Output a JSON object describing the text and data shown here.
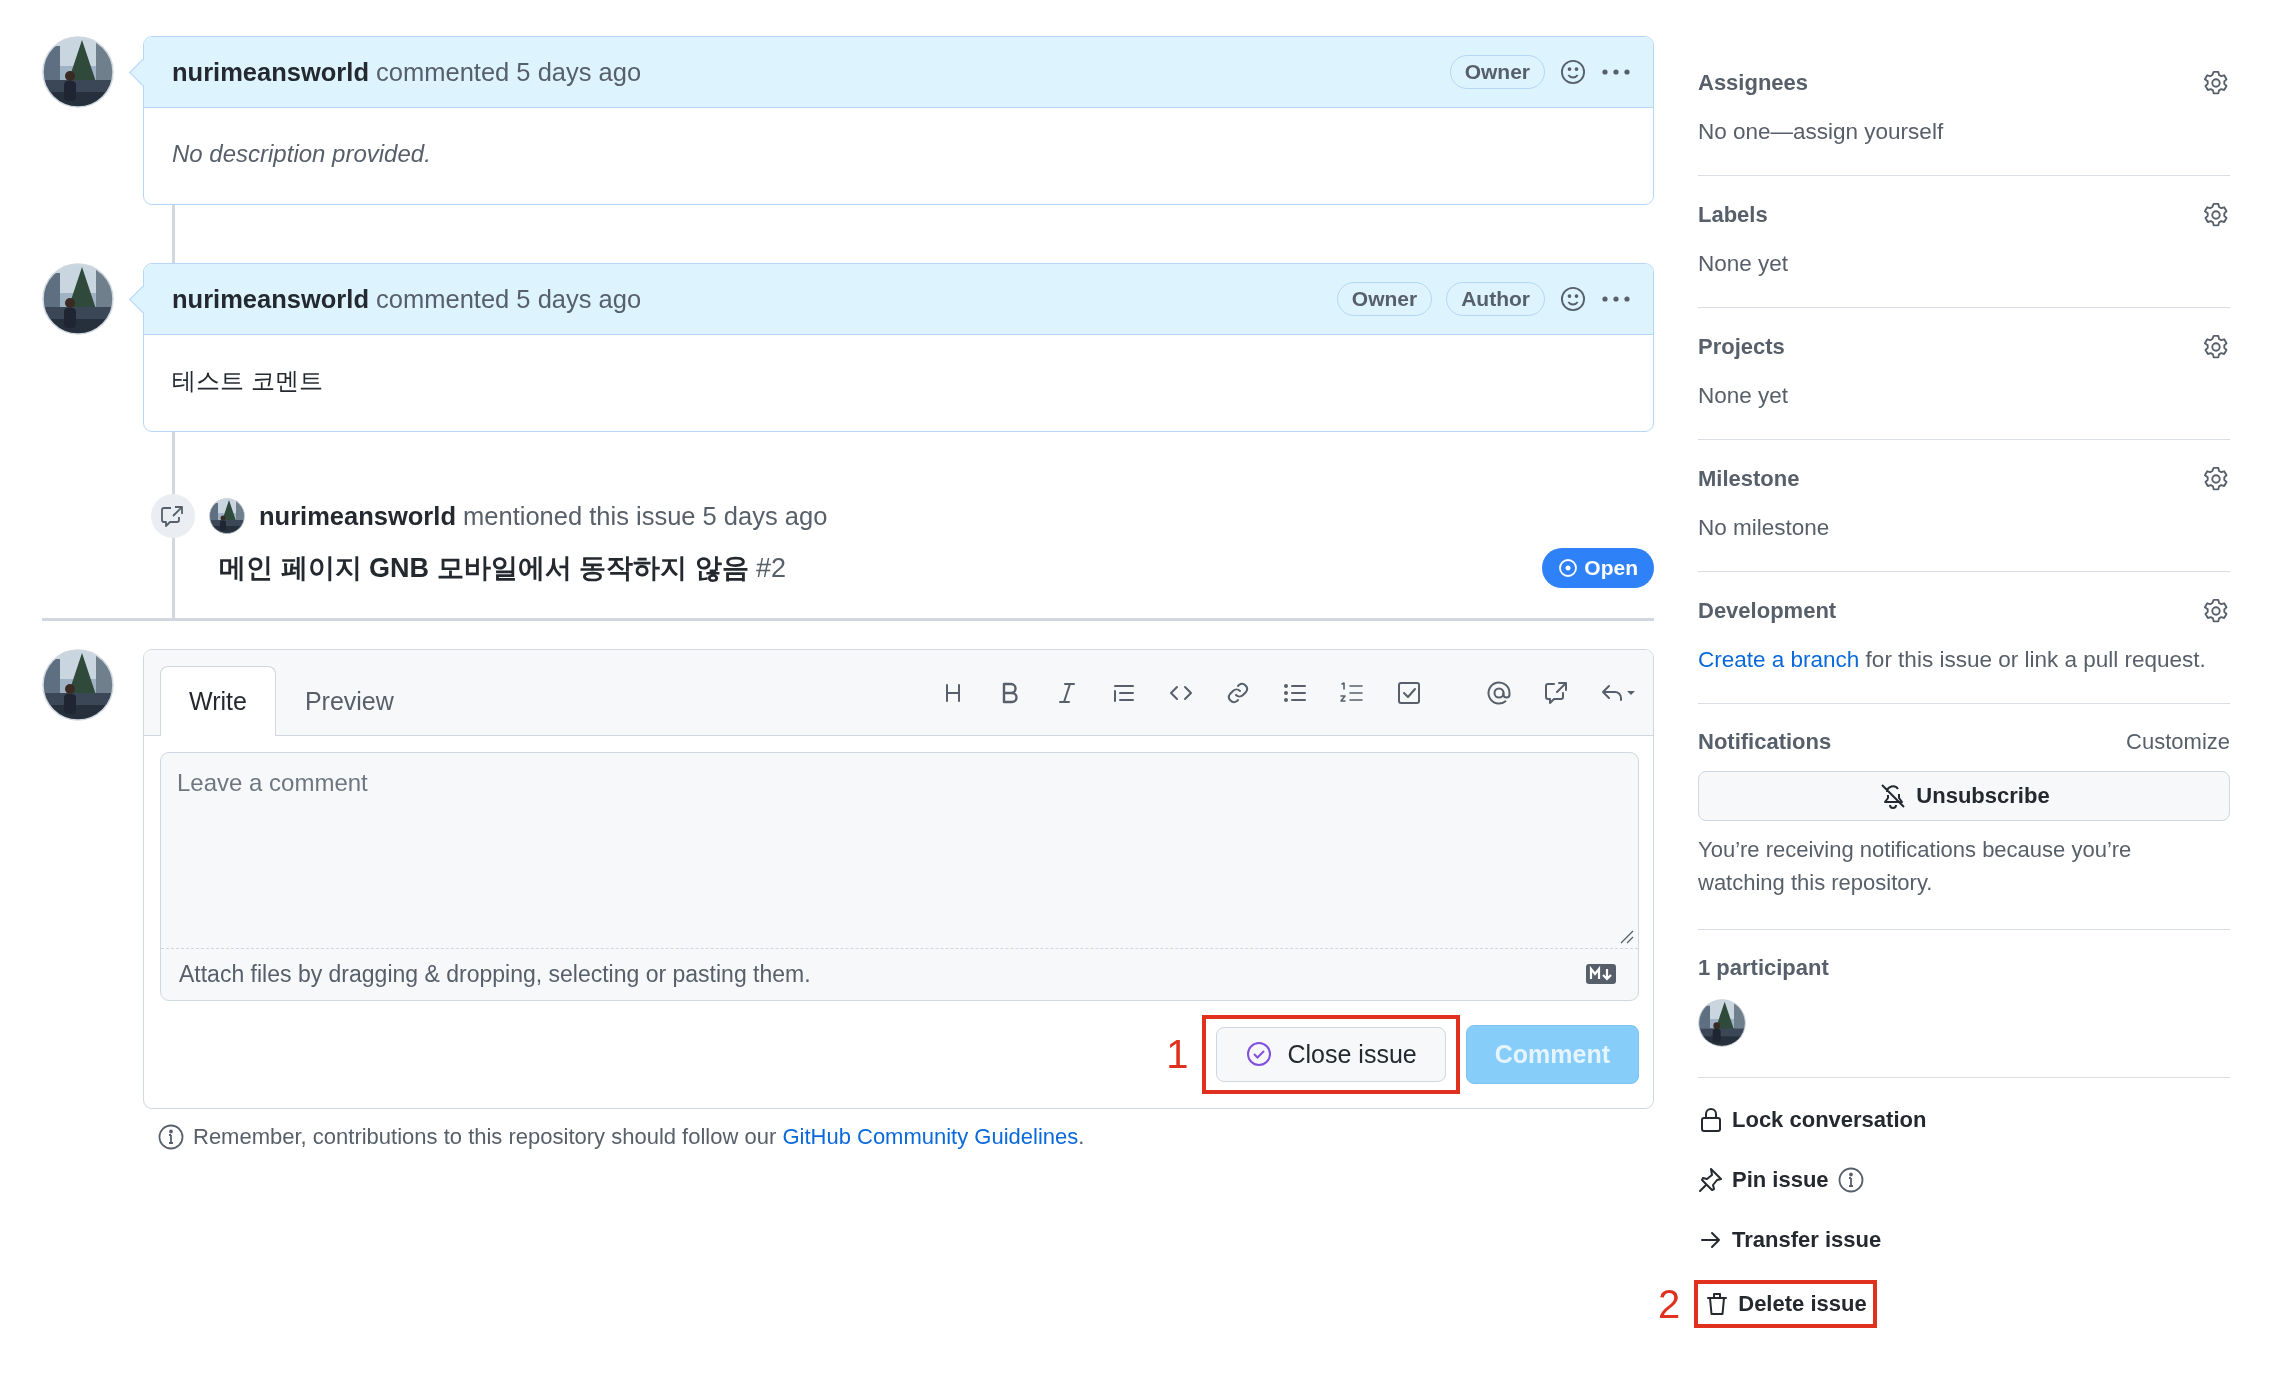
{
  "comments": [
    {
      "author": "nurimeansworld",
      "action": "commented 5 days ago",
      "badges": [
        "Owner"
      ],
      "kind": "empty",
      "body": "No description provided."
    },
    {
      "author": "nurimeansworld",
      "action": "commented 5 days ago",
      "badges": [
        "Owner",
        "Author"
      ],
      "kind": "text",
      "body": "테스트 코멘트"
    }
  ],
  "mention": {
    "author": "nurimeansworld",
    "action": "mentioned this issue 5 days ago",
    "issue_title": "메인 페이지 GNB 모바일에서 동작하지 않음",
    "issue_number": "#2",
    "open": true,
    "state_label": "Open"
  },
  "composer": {
    "tabs": [
      {
        "label": "Write",
        "selected": true
      },
      {
        "label": "Preview",
        "selected": false
      }
    ],
    "placeholder": "Leave a comment",
    "attach_hint": "Attach files by dragging & dropping, selecting or pasting them.",
    "close_button": "Close issue",
    "comment_button": {
      "label": "Comment",
      "disabled": true
    }
  },
  "guidelines": {
    "text": "Remember, contributions to this repository should follow our",
    "link": "GitHub Community Guidelines",
    "end": "."
  },
  "annotations": [
    {
      "number": "1"
    },
    {
      "number": "2"
    }
  ],
  "sidebar": {
    "sections": [
      {
        "title": "Assignees",
        "kind": "text",
        "value": "No one—assign yourself"
      },
      {
        "title": "Labels",
        "kind": "text",
        "value": "None yet"
      },
      {
        "title": "Projects",
        "kind": "text",
        "value": "None yet"
      },
      {
        "title": "Milestone",
        "kind": "text",
        "value": "No milestone"
      },
      {
        "title": "Development",
        "kind": "link",
        "link": "Create a branch",
        "value": "for this issue or link a pull request."
      }
    ],
    "notifications": {
      "title": "Notifications",
      "customize": "Customize",
      "button": "Unsubscribe",
      "note": "You’re receiving notifications because you’re watching this repository."
    },
    "participants": {
      "title": "1 participant"
    },
    "actions": [
      {
        "kind": "lock",
        "label": "Lock conversation",
        "info": false
      },
      {
        "kind": "pin",
        "label": "Pin issue",
        "info": true
      },
      {
        "kind": "transfer",
        "label": "Transfer issue",
        "info": false
      },
      {
        "kind": "delete",
        "label": "Delete issue",
        "info": false
      }
    ]
  }
}
